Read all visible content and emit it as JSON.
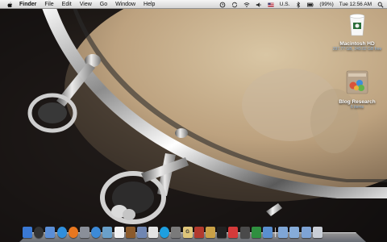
{
  "menubar": {
    "apple_icon": "apple-logo-icon",
    "app_name": "Finder",
    "items": [
      "File",
      "Edit",
      "View",
      "Go",
      "Window",
      "Help"
    ],
    "status": {
      "keyboard": "U.S.",
      "battery": "(99%)",
      "clock": "Tue 12:56 AM"
    },
    "status_icons": [
      "time-machine-icon",
      "sync-icon",
      "wifi-icon",
      "volume-icon",
      "input-flag-icon",
      "bluetooth-icon",
      "battery-icon",
      "spotlight-icon"
    ]
  },
  "desktop": {
    "hard_drive": {
      "name": "Macintosh HD",
      "info": "297.77 GB, 249.02 GB free",
      "icon": "hard-drive-icon"
    },
    "folder": {
      "name": "Blog Research",
      "info": "6 items",
      "icon": "folder-icon"
    }
  },
  "dock": {
    "apps": [
      {
        "icon": "finder-icon",
        "color": "#3a79d4",
        "glyph": ""
      },
      {
        "icon": "dashboard-icon",
        "color": "#333333",
        "glyph": ""
      },
      {
        "icon": "mail-icon",
        "color": "#5b8ed6",
        "glyph": ""
      },
      {
        "icon": "safari-icon",
        "color": "#2f8fdc",
        "glyph": ""
      },
      {
        "icon": "firefox-icon",
        "color": "#e8771f",
        "glyph": ""
      },
      {
        "icon": "system-preferences-icon",
        "color": "#8a8f99",
        "glyph": ""
      },
      {
        "icon": "itunes-icon",
        "color": "#3c8ad8",
        "glyph": ""
      },
      {
        "icon": "iphoto-icon",
        "color": "#6aa0c9",
        "glyph": ""
      },
      {
        "icon": "ical-icon",
        "color": "#f2f2f2",
        "glyph": ""
      },
      {
        "icon": "address-book-icon",
        "color": "#8b5a2b",
        "glyph": ""
      },
      {
        "icon": "preview-icon",
        "color": "#6f86b3",
        "glyph": ""
      },
      {
        "icon": "textedit-icon",
        "color": "#e4e4e4",
        "glyph": ""
      },
      {
        "icon": "skype-icon",
        "color": "#1e9fe0",
        "glyph": ""
      },
      {
        "icon": "scripteditor-icon",
        "color": "#7a7a7a",
        "glyph": ""
      },
      {
        "icon": "notes-icon",
        "color": "#dfc67a",
        "glyph": "G"
      },
      {
        "icon": "photobooth-icon",
        "color": "#b23a2e",
        "glyph": ""
      },
      {
        "icon": "garageband-icon",
        "color": "#c9a046",
        "glyph": ""
      },
      {
        "icon": "terminal-icon",
        "color": "#222222",
        "glyph": ""
      },
      {
        "icon": "adium-icon",
        "color": "#d43a3a",
        "glyph": ""
      },
      {
        "icon": "widget-icon",
        "color": "#4a4a4a",
        "glyph": ""
      },
      {
        "icon": "activity-monitor-icon",
        "color": "#2f8f3f",
        "glyph": ""
      },
      {
        "icon": "stickies-icon",
        "color": "#5a8fd0",
        "glyph": ""
      }
    ],
    "stacks": [
      {
        "icon": "applications-stack-icon",
        "color": "#7fa6d6"
      },
      {
        "icon": "documents-stack-icon",
        "color": "#86acd9"
      },
      {
        "icon": "downloads-stack-icon",
        "color": "#7ea3d4"
      },
      {
        "icon": "trash-icon",
        "color": "#c9ced6"
      }
    ]
  }
}
